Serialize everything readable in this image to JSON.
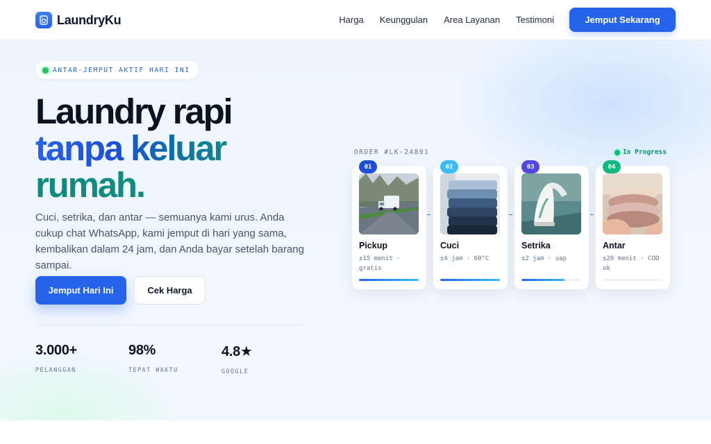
{
  "nav": {
    "brand": "LaundryKu",
    "links": [
      "Harga",
      "Keunggulan",
      "Area Layanan",
      "Testimoni"
    ],
    "cta": "Jemput Sekarang"
  },
  "hero": {
    "badge": "ANTAR-JEMPUT AKTIF HARI INI",
    "headline_line1": "Laundry rapi",
    "headline_line2": "tanpa keluar",
    "headline_line3": "rumah",
    "headline_dot": ".",
    "lead": "Cuci, setrika, dan antar — semuanya kami urus. Anda cukup chat WhatsApp, kami jemput di hari yang sama, kembalikan dalam 24 jam, dan Anda bayar setelah barang sampai.",
    "primary_button": "Jemput Hari Ini",
    "secondary_button": "Cek Harga",
    "stats": [
      {
        "value": "3.000+",
        "label": "PELANGGAN"
      },
      {
        "value": "98%",
        "label": "TEPAT WAKTU"
      },
      {
        "value": "4.8★",
        "label": "GOOGLE"
      }
    ]
  },
  "order": {
    "id": "ORDER #LK-24891",
    "status": "In Progress",
    "status_color": "#10b981",
    "steps": [
      {
        "num": "01",
        "title": "Pickup",
        "meta": "±15 menit · gratis",
        "progress": 1.0,
        "color": "#1d4ed8",
        "photo": "delivery-van-photo"
      },
      {
        "num": "02",
        "title": "Cuci",
        "meta": "±4 jam · 60°C",
        "progress": 1.0,
        "color": "#38bdf8",
        "photo": "folded-jeans-photo"
      },
      {
        "num": "03",
        "title": "Setrika",
        "meta": "±2 jam · uap",
        "progress": 0.72,
        "color": "#4f46e5",
        "photo": "iron-photo"
      },
      {
        "num": "04",
        "title": "Antar",
        "meta": "±20 menit · COD ok",
        "progress": 0.0,
        "color": "#10b981",
        "photo": "folded-clothes-photo"
      }
    ]
  },
  "colors": {
    "accent": "#2563eb",
    "teal": "#0f8b80"
  }
}
